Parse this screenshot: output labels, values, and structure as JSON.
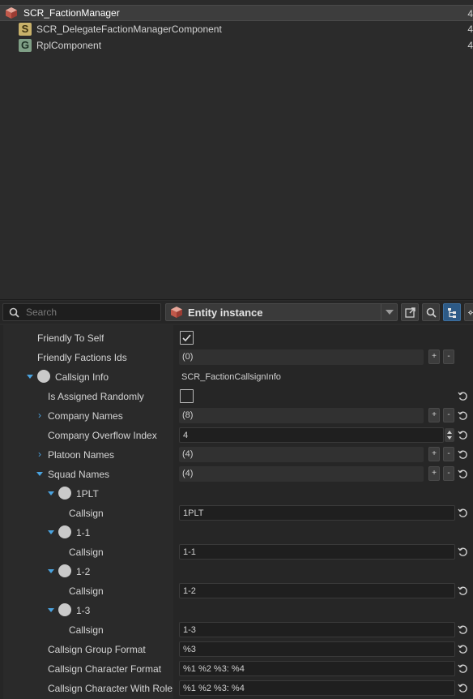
{
  "hierarchy": {
    "items": [
      {
        "label": "SCR_FactionManager",
        "count": "4",
        "icon": "entity-cube-icon",
        "selected": true
      },
      {
        "label": "SCR_DelegateFactionManagerComponent",
        "count": "4",
        "icon": "script-component-icon",
        "icon_letter": "S"
      },
      {
        "label": "RplComponent",
        "count": "4",
        "icon": "game-component-icon",
        "icon_letter": "G"
      }
    ]
  },
  "toolbar": {
    "search_placeholder": "Search",
    "mode_label": "Entity instance"
  },
  "properties": [
    {
      "label": "Friendly To Self",
      "type": "checkbox",
      "checked": true
    },
    {
      "label": "Friendly Factions Ids",
      "type": "array",
      "value": "(0)",
      "reset": false
    },
    {
      "label": "Callsign Info",
      "type": "object",
      "value": "SCR_FactionCallsignInfo",
      "expanded": true
    },
    {
      "label": "Is Assigned Randomly",
      "type": "checkbox",
      "checked": false,
      "reset": true
    },
    {
      "label": "Company Names",
      "type": "array",
      "value": "(8)",
      "expanded": false,
      "reset": true
    },
    {
      "label": "Company Overflow Index",
      "type": "number",
      "value": "4",
      "reset": true
    },
    {
      "label": "Platoon Names",
      "type": "array",
      "value": "(4)",
      "expanded": false,
      "reset": true
    },
    {
      "label": "Squad Names",
      "type": "array",
      "value": "(4)",
      "expanded": true,
      "reset": true
    },
    {
      "label": "1PLT",
      "type": "element"
    },
    {
      "label": "Callsign",
      "type": "text",
      "value": "1PLT",
      "reset": true
    },
    {
      "label": "1-1",
      "type": "element"
    },
    {
      "label": "Callsign",
      "type": "text",
      "value": "1-1",
      "reset": true
    },
    {
      "label": "1-2",
      "type": "element"
    },
    {
      "label": "Callsign",
      "type": "text",
      "value": "1-2",
      "reset": true
    },
    {
      "label": "1-3",
      "type": "element"
    },
    {
      "label": "Callsign",
      "type": "text",
      "value": "1-3",
      "reset": true
    },
    {
      "label": "Callsign Group Format",
      "type": "text",
      "value": "%3",
      "reset": true
    },
    {
      "label": "Callsign Character Format",
      "type": "text",
      "value": "%1 %2 %3: %4",
      "reset": true
    },
    {
      "label": "Callsign Character With Role Format",
      "type": "text",
      "value": "%1 %2 %3: %4",
      "reset": true
    }
  ],
  "array_buttons": {
    "add": "+",
    "remove": "-"
  },
  "colors": {
    "accent": "#4aa3df",
    "selected_row": "#3d3d3d",
    "panel": "#262626"
  }
}
